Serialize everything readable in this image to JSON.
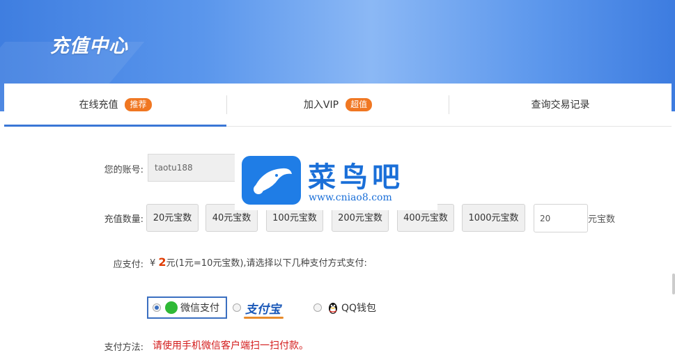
{
  "header": {
    "title": "充值中心"
  },
  "tabs": [
    {
      "label": "在线充值",
      "badge": "推荐",
      "active": true
    },
    {
      "label": "加入VIP",
      "badge": "超值",
      "active": false
    },
    {
      "label": "查询交易记录",
      "badge": "",
      "active": false
    }
  ],
  "form": {
    "account_label": "您的账号:",
    "account_value": "taotu188",
    "quantity_label": "充值数量:",
    "quantity_options": [
      "20元宝数",
      "40元宝数",
      "100元宝数",
      "200元宝数",
      "400元宝数",
      "1000元宝数"
    ],
    "custom_quantity_value": "20",
    "custom_quantity_unit": "元宝数",
    "amount_label": "应支付:",
    "amount_currency": "¥",
    "amount_value": "2",
    "amount_note": "元(1元=10元宝数),请选择以下几种支付方式支付:",
    "payment_methods": [
      {
        "label": "微信支付",
        "selected": true
      },
      {
        "label": "支付宝",
        "selected": false
      },
      {
        "label": "QQ钱包",
        "selected": false
      }
    ],
    "method_label": "支付方法:",
    "method_note": "请使用手机微信客户端扫一扫付款。"
  },
  "watermark": {
    "text": "菜鸟吧",
    "url": "www.cniao8.com"
  },
  "colors": {
    "accent": "#3a77d6",
    "badge": "#f07722",
    "price": "#e03a00",
    "note": "#d31a1a",
    "wechat": "#2fb936"
  }
}
